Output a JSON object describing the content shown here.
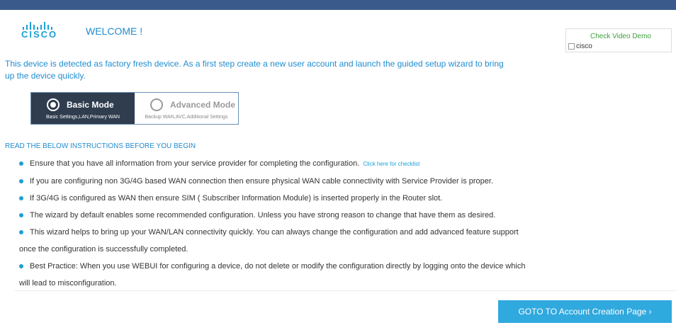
{
  "header": {
    "logo_text": "CISCO",
    "welcome_title": "WELCOME !"
  },
  "video_demo": {
    "link_label": "Check Video Demo",
    "image_alt": "cisco"
  },
  "intro_text": "This device is detected as factory fresh device. As a first step create a new user account and launch the guided setup wizard to bring up the device quickly.",
  "mode_switch": {
    "basic": {
      "title": "Basic Mode",
      "subtitle": "Basic Settings,LAN,Primary WAN",
      "selected": true
    },
    "advanced": {
      "title": "Advanced Mode",
      "subtitle": "Backup WAN,AVC,Additional Settings",
      "selected": false
    }
  },
  "instructions_heading": "READ THE BELOW INSTRUCTIONS BEFORE YOU BEGIN",
  "instructions": [
    {
      "text": "Ensure that you have all information from your service provider for completing the configuration.",
      "link": "Click here for checklist"
    },
    {
      "text": "If you are configuring non 3G/4G based WAN connection then ensure physical WAN cable connectivity with Service Provider is proper."
    },
    {
      "text": "If 3G/4G is configured as WAN then ensure SIM ( Subscriber Information Module) is inserted properly in the Router slot."
    },
    {
      "text": "The wizard by default enables some recommended configuration. Unless you have strong reason to change that have them as desired."
    },
    {
      "text": "This wizard helps to bring up your WAN/LAN connectivity quickly. You can always change the configuration and add advanced feature support",
      "continuation": "once the configuration is successfully completed."
    },
    {
      "text": "Best Practice: When you use WEBUI for configuring a device, do not delete or modify the configuration directly by logging onto the device which",
      "continuation": "will lead to misconfiguration."
    }
  ],
  "footer": {
    "goto_button_label": "GOTO TO Account Creation Page ›"
  },
  "colors": {
    "top_bar": "#3a5a8c",
    "accent_blue": "#1f8ccf",
    "button_blue": "#30a9de",
    "basic_mode_bg": "#2f3d4f",
    "demo_link_green": "#3f9f3f"
  }
}
